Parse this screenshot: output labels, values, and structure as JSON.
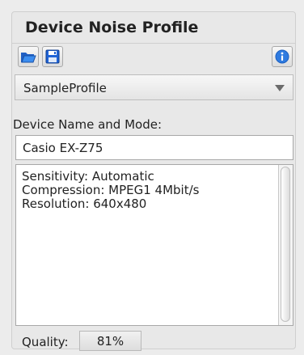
{
  "panel": {
    "title": "Device Noise Profile"
  },
  "toolbar": {
    "open_icon": "folder-open-icon",
    "save_icon": "floppy-save-icon",
    "info_icon": "info-icon"
  },
  "profile_select": {
    "selected": "SampleProfile"
  },
  "device": {
    "label": "Device Name and Mode:",
    "name_value": "Casio EX-Z75",
    "details": [
      "Sensitivity: Automatic",
      "Compression: MPEG1 4Mbit/s",
      "Resolution: 640x480"
    ]
  },
  "quality": {
    "label": "Quality:",
    "value": "81%"
  },
  "colors": {
    "panel_bg": "#e8e8e8",
    "accent_blue": "#2f7be0"
  }
}
